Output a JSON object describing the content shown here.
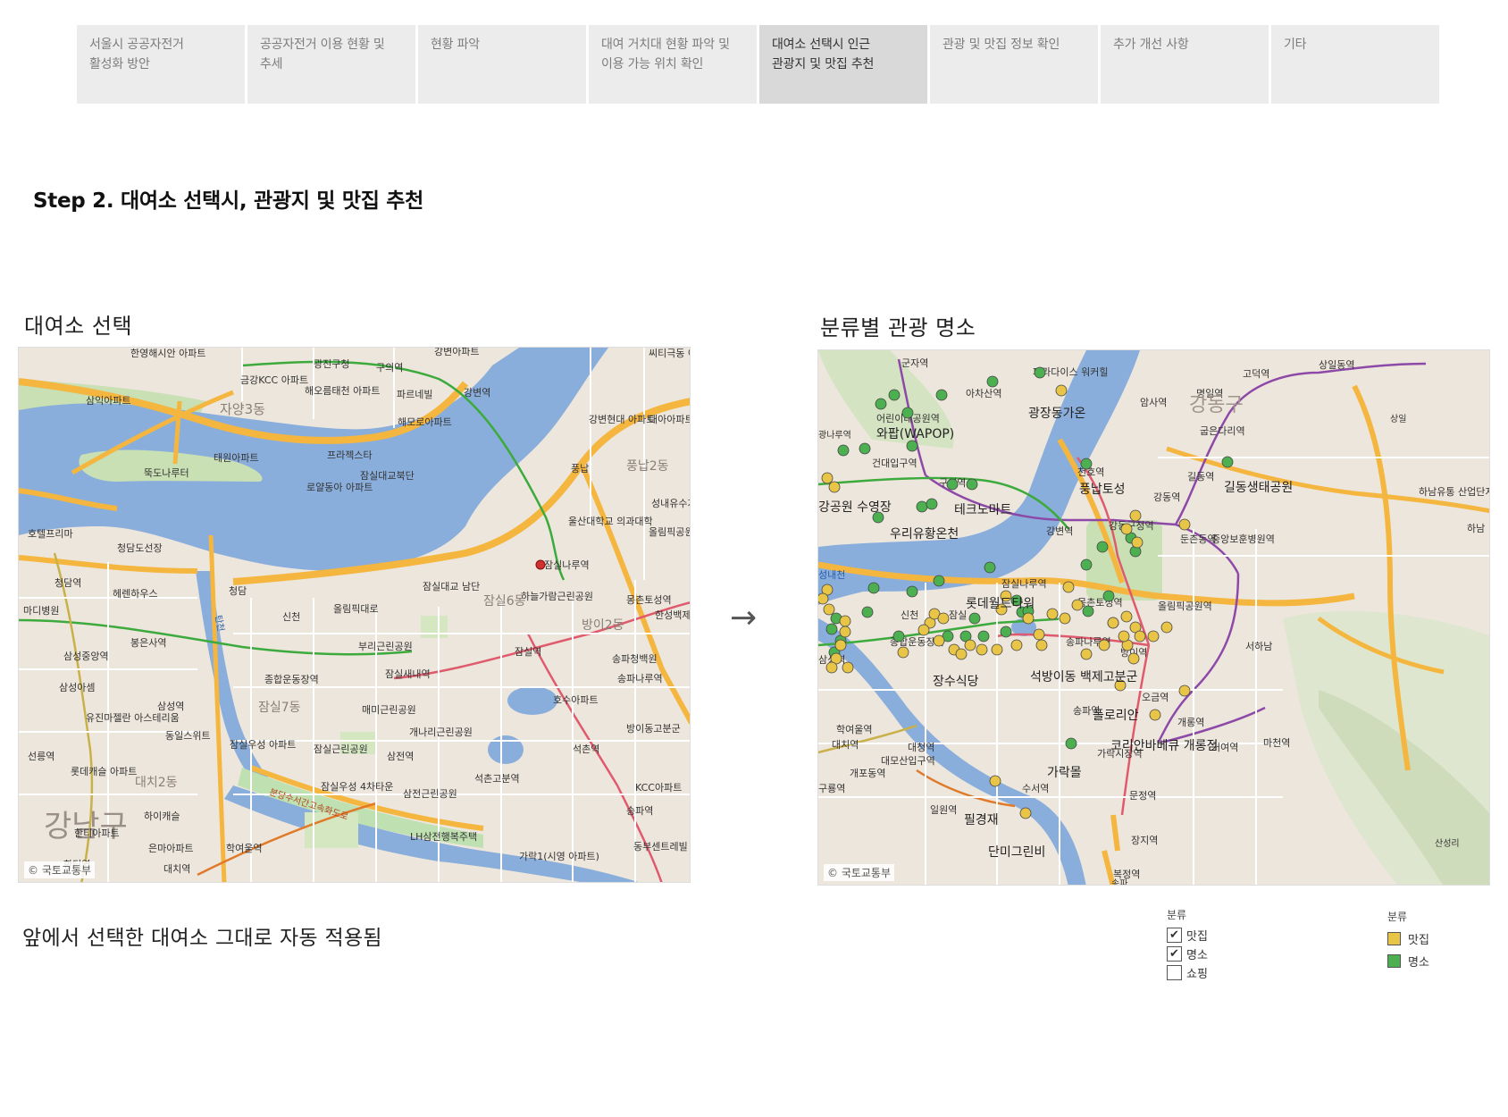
{
  "tabs": [
    {
      "label": "서울시 공공자전거\n활성화 방안",
      "active": false
    },
    {
      "label": "공공자전거 이용 현황 및\n추세",
      "active": false
    },
    {
      "label": "현황 파악",
      "active": false
    },
    {
      "label": "대여 거치대 현황 파악 및\n이용 가능 위치 확인",
      "active": false
    },
    {
      "label": "대여소 선택시 인근\n관광지 및 맛집 추천",
      "active": true
    },
    {
      "label": "관광 및 맛집 정보 확인",
      "active": false
    },
    {
      "label": "추가 개선 사항",
      "active": false
    },
    {
      "label": "기타",
      "active": false
    }
  ],
  "page": {
    "step_title": "Step 2. 대여소 선택시, 관광지 및 맛집 추천",
    "left_label": "대여소 선택",
    "right_label": "분류별 관광 명소",
    "footnote": "앞에서 선택한 대여소 그대로 자동 적용됨",
    "arrow": "→"
  },
  "left_map": {
    "copyright": "© 국토교통부",
    "labels": [
      "한영해시안 아파트",
      "광진구청",
      "구의역",
      "강변아파트",
      "씨티극동 아파트",
      "금강KCC 아파트",
      "해오름태천 아파트",
      "파르네빌",
      "강변역",
      "삼익아파트",
      "자양3동",
      "해모로아파트",
      "강변현대 아파트",
      "대아아파트",
      "태원아파트",
      "프라젝스타",
      "잠실대교북단",
      "풍납",
      "뚝도나루터",
      "로얄동아 아파트",
      "풍납2동",
      "성내유수지",
      "호텔프리마",
      "울산대학교 의과대학",
      "청담도선장",
      "올림픽공원 옹촌토성",
      "청담역",
      "헤렌하우스",
      "잠실나루역",
      "마디병원",
      "청담",
      "신천",
      "잠실대교 남단",
      "하늘가람근린공원",
      "몽촌토성역",
      "한성백제",
      "올림픽대로",
      "잠실6동",
      "방이2동",
      "봉은사역",
      "부리근린공원",
      "잠실역",
      "송파청백원",
      "삼성중앙역",
      "종합운동장역",
      "잠실새내역",
      "송파나루역",
      "삼성아셈",
      "매미근린공원",
      "호수아파트",
      "삼성역",
      "잠실7동",
      "개나리근린공원",
      "유진마젤란 아스테리움",
      "동일스위트",
      "잠실우성 아파트",
      "방이동고분군",
      "선릉역",
      "잠실근린공원",
      "삼전역",
      "석촌역",
      "롯데캐슬 아파트",
      "대치2동",
      "석촌고분역",
      "KCC아파트",
      "잠실우성 4차타운",
      "삼전근린공원",
      "하이캐슬",
      "송파역",
      "강남구",
      "한티아파트",
      "은마아파트",
      "학여울역",
      "LH삼전행복주택",
      "한티역",
      "대치역",
      "가락1(시영 아파트)",
      "동부센트레빌 아파트",
      "분당수서간고속화도로",
      "탄천"
    ]
  },
  "right_map": {
    "copyright": "© 국토교통부",
    "poi_labels": [
      "와팝(WAPOP)",
      "광장동가온",
      "강공원 수영장",
      "테크노마트",
      "우리유황온천",
      "풍납토성",
      "길동생태공원",
      "롯데월드타워",
      "장수식당",
      "석방이동 백제고분군",
      "플로리안",
      "코리안바베큐 개롱점",
      "가락몰",
      "필경재",
      "단미그린비"
    ],
    "station_labels": [
      "군자역",
      "아차산역",
      "광나루역",
      "어린이대공원역",
      "건대입구역",
      "구의역",
      "강변역",
      "천호역",
      "강동역",
      "암사역",
      "명일역",
      "고덕역",
      "상일동역",
      "굽은다리역",
      "길동역",
      "둔촌동역",
      "강동구청역",
      "몽촌토성역",
      "잠실나루역",
      "올림픽공원역",
      "송파나루역",
      "방이역",
      "오금역",
      "개롱역",
      "거여역",
      "마천역",
      "가락시장역",
      "송파역",
      "문정역",
      "장지역",
      "수서역",
      "복정역",
      "대치역",
      "학여울역",
      "대청역",
      "일원역",
      "개포동역",
      "대모산입구역",
      "구룡역",
      "중앙보훈병원역",
      "서하남",
      "하남",
      "삼성역",
      "종합운동장역",
      "신천",
      "잠실",
      "하남유통 산업단지",
      "성내천",
      "강동구",
      "상일",
      "송파",
      "산성리",
      "파라다이스 워커힐"
    ]
  },
  "filter_legend": {
    "title": "분류",
    "items": [
      {
        "label": "맛집",
        "checked": true
      },
      {
        "label": "명소",
        "checked": true
      },
      {
        "label": "쇼핑",
        "checked": false
      }
    ]
  },
  "color_legend": {
    "title": "분류",
    "items": [
      {
        "label": "맛집",
        "color": "#e8c547"
      },
      {
        "label": "명소",
        "color": "#4caf50"
      }
    ]
  },
  "colors": {
    "restaurant": "#e8c547",
    "attraction": "#4caf50",
    "river": "#8aaedb",
    "expressway": "#f4b63f",
    "selected_station": "#d32f2f"
  }
}
